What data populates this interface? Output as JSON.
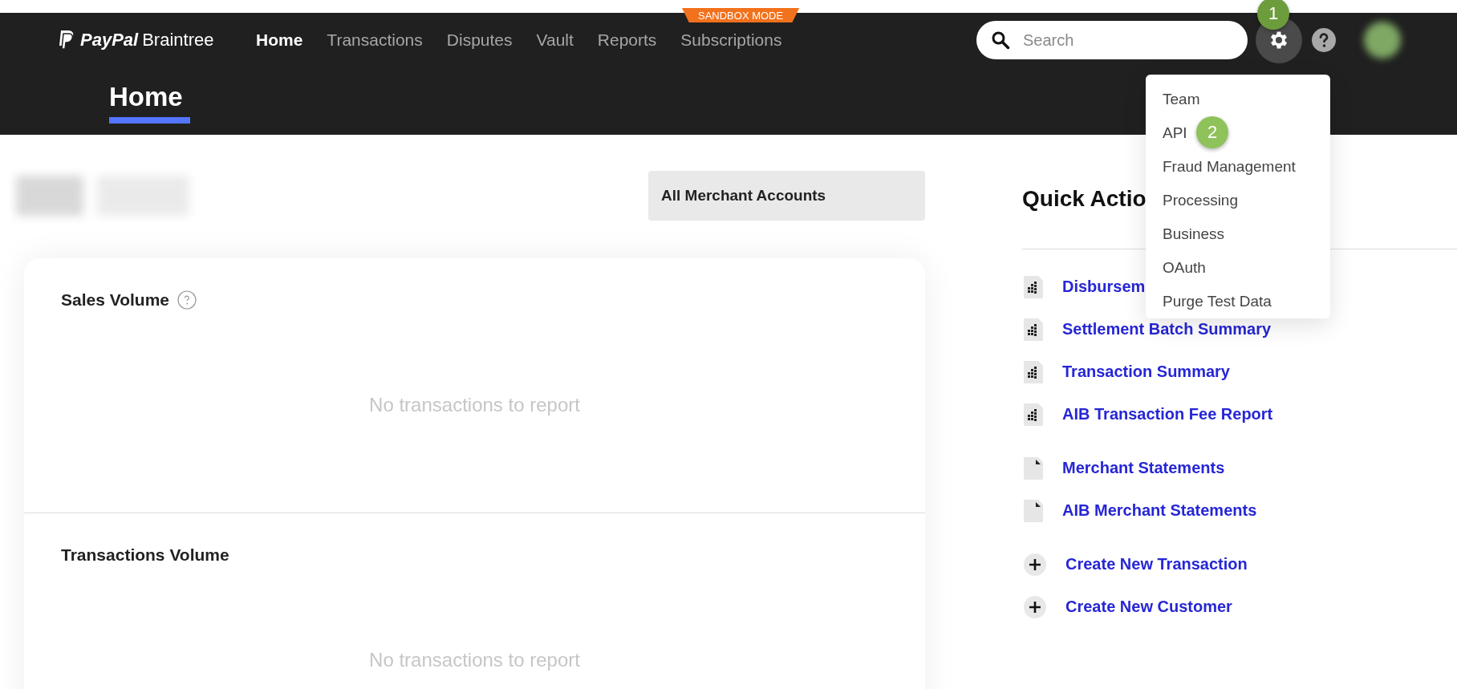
{
  "header": {
    "brand": {
      "paypal": "PayPal",
      "braintree": "Braintree"
    },
    "nav": [
      {
        "label": "Home",
        "selected": true
      },
      {
        "label": "Transactions",
        "selected": false
      },
      {
        "label": "Disputes",
        "selected": false
      },
      {
        "label": "Vault",
        "selected": false
      },
      {
        "label": "Reports",
        "selected": false
      },
      {
        "label": "Subscriptions",
        "selected": false
      }
    ],
    "sandbox_label": "SANDBOX MODE",
    "search": {
      "placeholder": "Search"
    },
    "settings_badge": "1",
    "page_title": "Home"
  },
  "settings_menu": {
    "items": [
      {
        "label": "Team"
      },
      {
        "label": "API",
        "badge": "2"
      },
      {
        "label": "Fraud Management"
      },
      {
        "label": "Processing"
      },
      {
        "label": "Business"
      },
      {
        "label": "OAuth"
      },
      {
        "label": "Purge Test Data"
      }
    ]
  },
  "merchant_selector": "All Merchant Accounts",
  "panels": [
    {
      "title": "Sales Volume",
      "help": true,
      "empty_text": "No transactions to report"
    },
    {
      "title": "Transactions Volume",
      "help": false,
      "empty_text": "No transactions to report"
    }
  ],
  "quick_actions": {
    "title": "Quick Actio",
    "items": [
      {
        "kind": "report",
        "label": "Disbursem"
      },
      {
        "kind": "report",
        "label": "Settlement Batch Summary"
      },
      {
        "kind": "report",
        "label": "Transaction Summary"
      },
      {
        "kind": "report",
        "label": "AIB Transaction Fee Report"
      },
      {
        "kind": "statement",
        "label": "Merchant Statements"
      },
      {
        "kind": "statement",
        "label": "AIB Merchant Statements"
      },
      {
        "kind": "create",
        "label": "Create New Transaction"
      },
      {
        "kind": "create",
        "label": "Create New Customer"
      }
    ]
  }
}
